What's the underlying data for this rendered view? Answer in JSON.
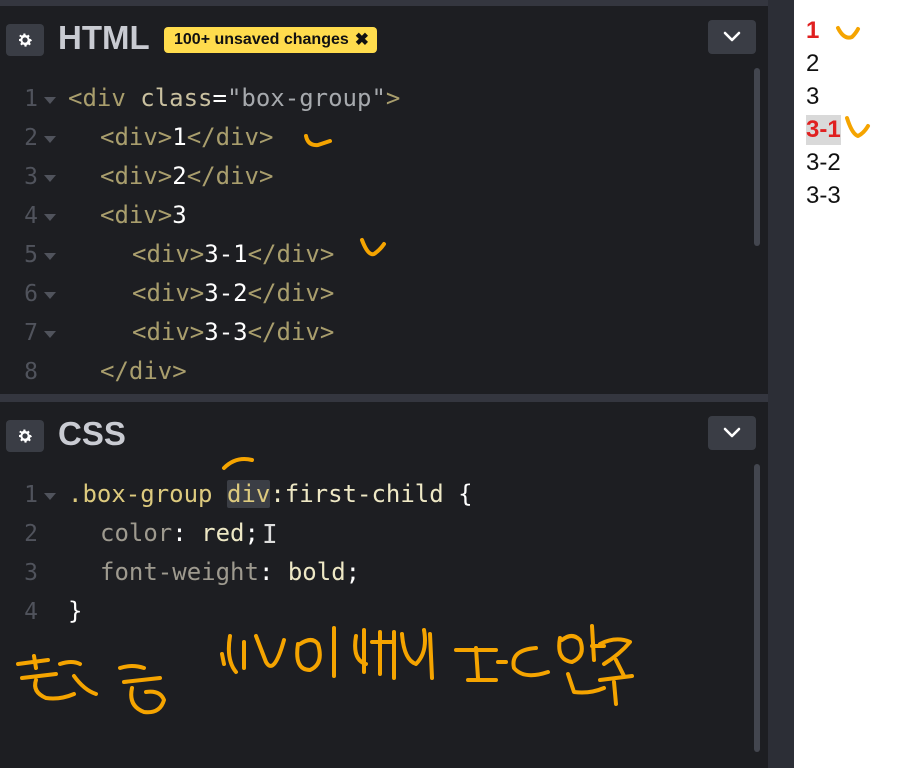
{
  "html_panel": {
    "title": "HTML",
    "badge": "100+ unsaved changes",
    "lines": [
      {
        "num": "1"
      },
      {
        "num": "2"
      },
      {
        "num": "3"
      },
      {
        "num": "4"
      },
      {
        "num": "5"
      },
      {
        "num": "6"
      },
      {
        "num": "7"
      },
      {
        "num": "8"
      }
    ],
    "tokens": {
      "open_div": "<div",
      "class_attr": "class",
      "eq": "=",
      "class_val": "\"box-group\"",
      "gt": ">",
      "div_open": "<div>",
      "div_close": "</div>",
      "t1": "1",
      "t2": "2",
      "t3": "3",
      "t31": "3-1",
      "t32": "3-2",
      "t33": "3-3"
    }
  },
  "css_panel": {
    "title": "CSS",
    "lines": [
      {
        "num": "1"
      },
      {
        "num": "2"
      },
      {
        "num": "3"
      },
      {
        "num": "4"
      }
    ],
    "selector_class": ".box-group",
    "selector_el": "div",
    "selector_pseudo": ":first-child",
    "brace_open": "{",
    "brace_close": "}",
    "prop1": "color",
    "val1": "red",
    "prop2": "font-weight",
    "val2": "bold",
    "colon": ":",
    "semi": ";"
  },
  "preview": {
    "items": [
      "1",
      "2",
      "3",
      "3-1",
      "3-2",
      "3-3"
    ]
  },
  "colors": {
    "annotation_ink": "#f5a400",
    "badge_bg": "#ffdc4d",
    "output_red": "#e02020"
  },
  "icons": {
    "settings": "gear-icon",
    "collapse": "chevron-down-icon",
    "badge_close": "close-icon"
  }
}
